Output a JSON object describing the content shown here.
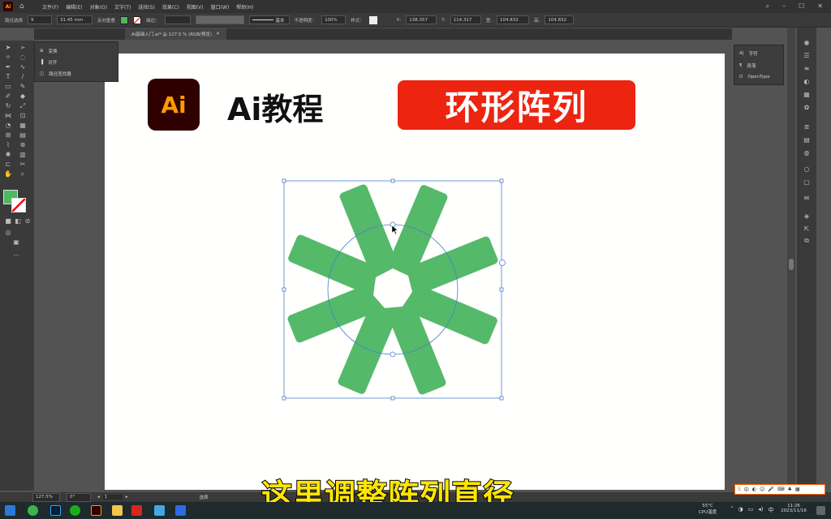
{
  "menubar": {
    "app_logo": "Ai",
    "items": [
      "文件(F)",
      "编辑(E)",
      "对象(O)",
      "文字(T)",
      "选择(S)",
      "效果(C)",
      "视图(V)",
      "窗口(W)",
      "帮助(H)"
    ]
  },
  "controlbar": {
    "mode_label": "路径选择",
    "stroke_weight": "9",
    "angle_value": "31.45 mm",
    "reverse_label": "反向重叠",
    "fill_color": "#4fb864",
    "stroke_label": "描边：",
    "stroke_style": "基本",
    "opacity_label": "不透明度：",
    "opacity_value": "100%",
    "style_label": "样式：",
    "x_label": "X:",
    "x_value": "138.357",
    "y_label": "Y:",
    "y_value": "114.317",
    "w_label": "宽:",
    "w_value": "104.832",
    "h_label": "高:",
    "h_value": "104.832"
  },
  "document_tab": {
    "title": "Ai基础入门.ai* @ 127.5 % (RGB/预览)"
  },
  "float_panel": {
    "items": [
      "变换",
      "对齐",
      "路径查找器"
    ]
  },
  "right_panel": {
    "items": [
      "字符",
      "段落",
      "OpenType"
    ]
  },
  "artboard": {
    "logo_text": "Ai",
    "heading": "Ai教程",
    "badge_text": "环形阵列",
    "shape_color": "#55b96a",
    "badge_color": "#ec2410"
  },
  "subtitle": "这里调整阵列直径",
  "statusbar": {
    "zoom": "127.5%",
    "rotation": "0°",
    "artboard_num": "1",
    "tool_name": "选择"
  },
  "taskbar": {
    "temperature": "55°C",
    "cpu_label": "CPU温度",
    "time": "11:26",
    "date": "2023/11/16"
  },
  "ime_widget": "中"
}
